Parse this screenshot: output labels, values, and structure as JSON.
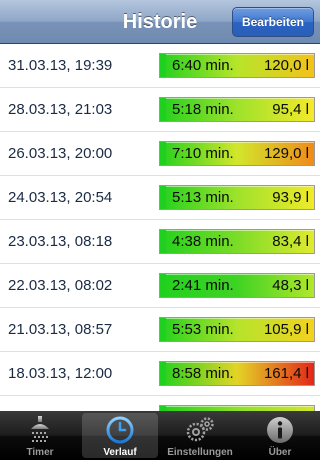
{
  "header": {
    "title": "Historie",
    "edit_label": "Bearbeiten"
  },
  "colors": {
    "stripe": "#1fd021"
  },
  "history": [
    {
      "date": "31.03.13, 19:39",
      "duration": "6:40 min.",
      "volume": "120,0 l",
      "grad": [
        "#22d11e",
        "#b7e52a",
        "#f3c21c"
      ]
    },
    {
      "date": "28.03.13, 21:03",
      "duration": "5:18 min.",
      "volume": "95,4 l",
      "grad": [
        "#22d11e",
        "#9ee22b",
        "#f5e92a"
      ]
    },
    {
      "date": "26.03.13, 20:00",
      "duration": "7:10 min.",
      "volume": "129,0 l",
      "grad": [
        "#22d11e",
        "#d2e62b",
        "#ef8b1a"
      ]
    },
    {
      "date": "24.03.13, 20:54",
      "duration": "5:13 min.",
      "volume": "93,9 l",
      "grad": [
        "#22d11e",
        "#9ee22b",
        "#f1ea2a"
      ]
    },
    {
      "date": "23.03.13, 08:18",
      "duration": "4:38 min.",
      "volume": "83,4 l",
      "grad": [
        "#22d11e",
        "#7bdc27",
        "#e0ea30"
      ]
    },
    {
      "date": "22.03.13, 08:02",
      "duration": "2:41 min.",
      "volume": "48,3 l",
      "grad": [
        "#22d11e",
        "#3fd324",
        "#b2e72b"
      ]
    },
    {
      "date": "21.03.13, 08:57",
      "duration": "5:53 min.",
      "volume": "105,9 l",
      "grad": [
        "#22d11e",
        "#b5e42a",
        "#f3d21f"
      ]
    },
    {
      "date": "18.03.13, 12:00",
      "duration": "8:58 min.",
      "volume": "161,4 l",
      "grad": [
        "#22d11e",
        "#e3d426",
        "#e3261a"
      ]
    },
    {
      "date": "",
      "duration": "",
      "volume": "",
      "grad": [
        "#22d11e",
        "#8fe02a",
        "#d2e62b"
      ]
    }
  ],
  "tabs": [
    {
      "label": "Timer",
      "icon": "shower-icon"
    },
    {
      "label": "Verlauf",
      "icon": "clock-icon"
    },
    {
      "label": "Einstellungen",
      "icon": "gears-icon"
    },
    {
      "label": "Über",
      "icon": "info-icon"
    }
  ]
}
